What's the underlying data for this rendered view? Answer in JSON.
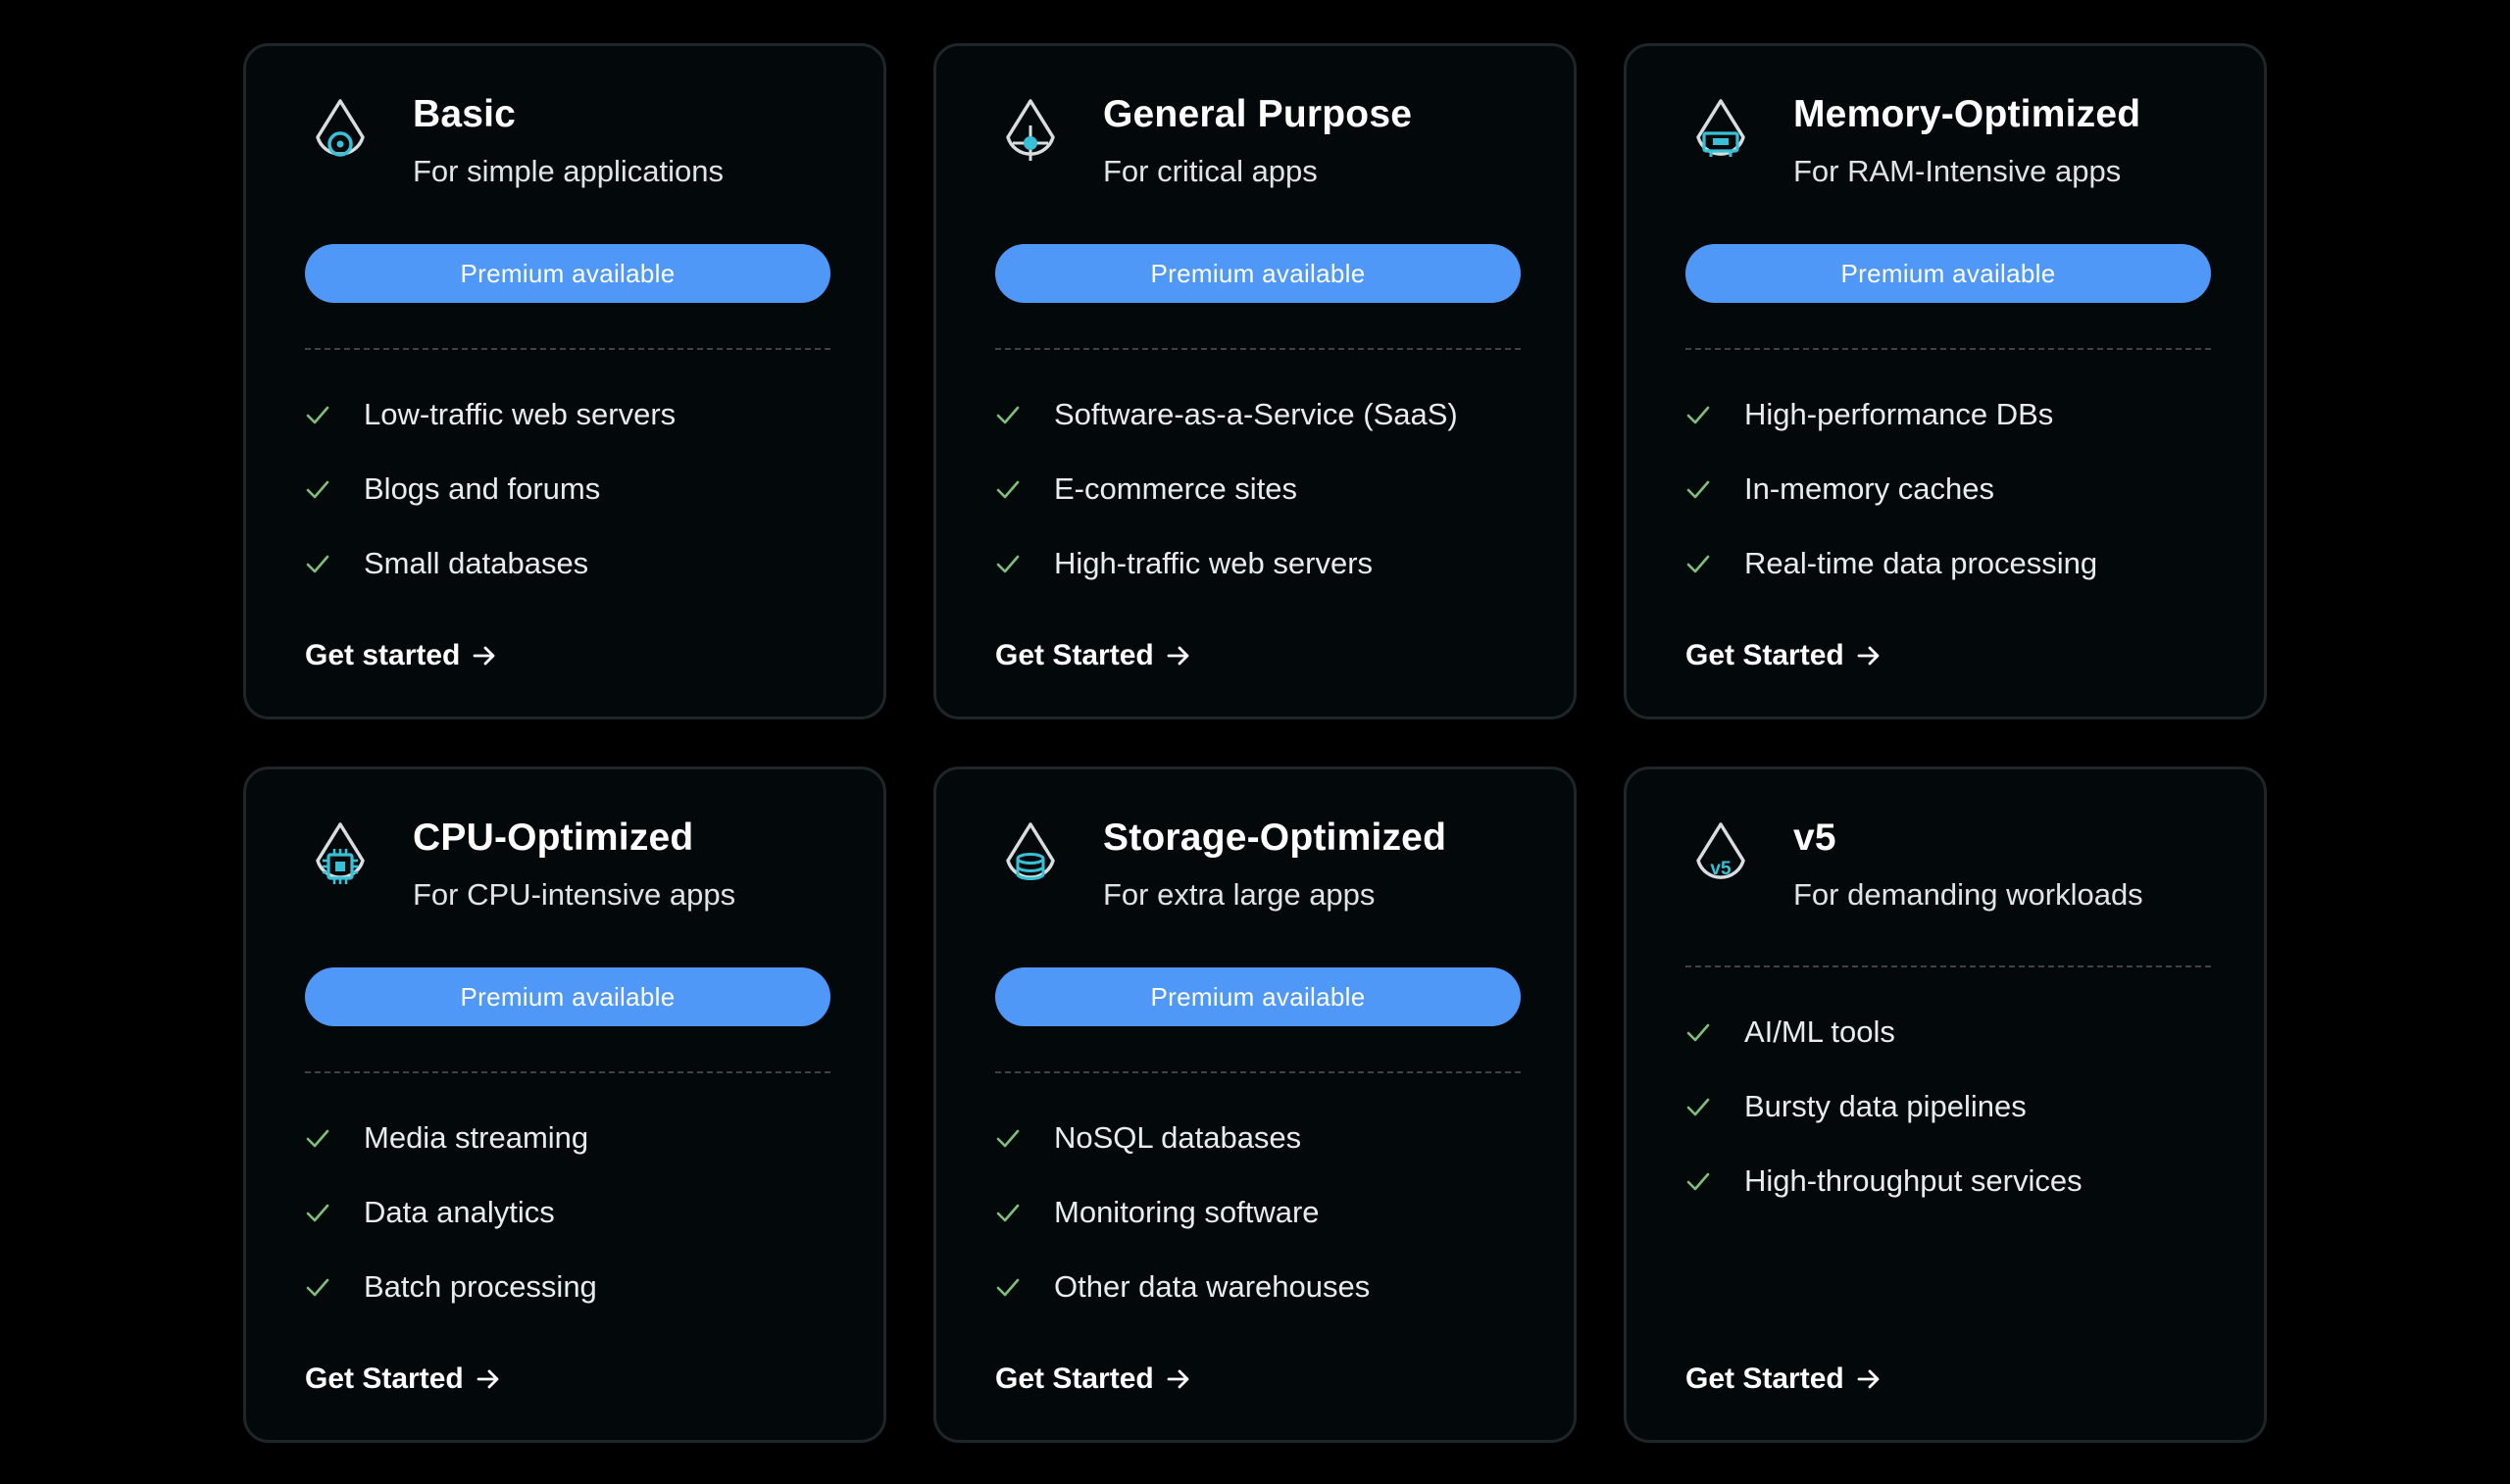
{
  "colors": {
    "background": "#000000",
    "card": "#03090b",
    "card_border": "#1e2629",
    "accent_blue": "#4f98f7",
    "icon_teal": "#38c1d6",
    "check_green": "#7ec07a"
  },
  "cards": [
    {
      "title": "Basic",
      "subtitle": "For simple applications",
      "icon": "droplet-target-icon",
      "badge": "Premium available",
      "features": [
        "Low-traffic web servers",
        "Blogs and forums",
        "Small databases"
      ],
      "cta": "Get started"
    },
    {
      "title": "General Purpose",
      "subtitle": "For critical apps",
      "icon": "droplet-crosshair-icon",
      "badge": "Premium available",
      "features": [
        "Software-as-a-Service (SaaS)",
        "E-commerce sites",
        "High-traffic web servers"
      ],
      "cta": "Get Started"
    },
    {
      "title": "Memory-Optimized",
      "subtitle": "For RAM-Intensive apps",
      "icon": "droplet-memory-icon",
      "badge": "Premium available",
      "features": [
        "High-performance DBs",
        "In-memory caches",
        "Real-time data processing"
      ],
      "cta": "Get Started"
    },
    {
      "title": "CPU-Optimized",
      "subtitle": "For CPU-intensive apps",
      "icon": "droplet-cpu-icon",
      "badge": "Premium available",
      "features": [
        "Media streaming",
        "Data analytics",
        "Batch processing"
      ],
      "cta": "Get Started"
    },
    {
      "title": "Storage-Optimized",
      "subtitle": "For extra large apps",
      "icon": "droplet-storage-icon",
      "badge": "Premium available",
      "features": [
        "NoSQL databases",
        "Monitoring software",
        "Other data warehouses"
      ],
      "cta": "Get Started"
    },
    {
      "title": "v5",
      "subtitle": "For demanding workloads",
      "icon": "droplet-v5-icon",
      "icon_text": "v5",
      "features": [
        "AI/ML tools",
        "Bursty data pipelines",
        "High-throughput services"
      ],
      "cta": "Get Started"
    }
  ]
}
